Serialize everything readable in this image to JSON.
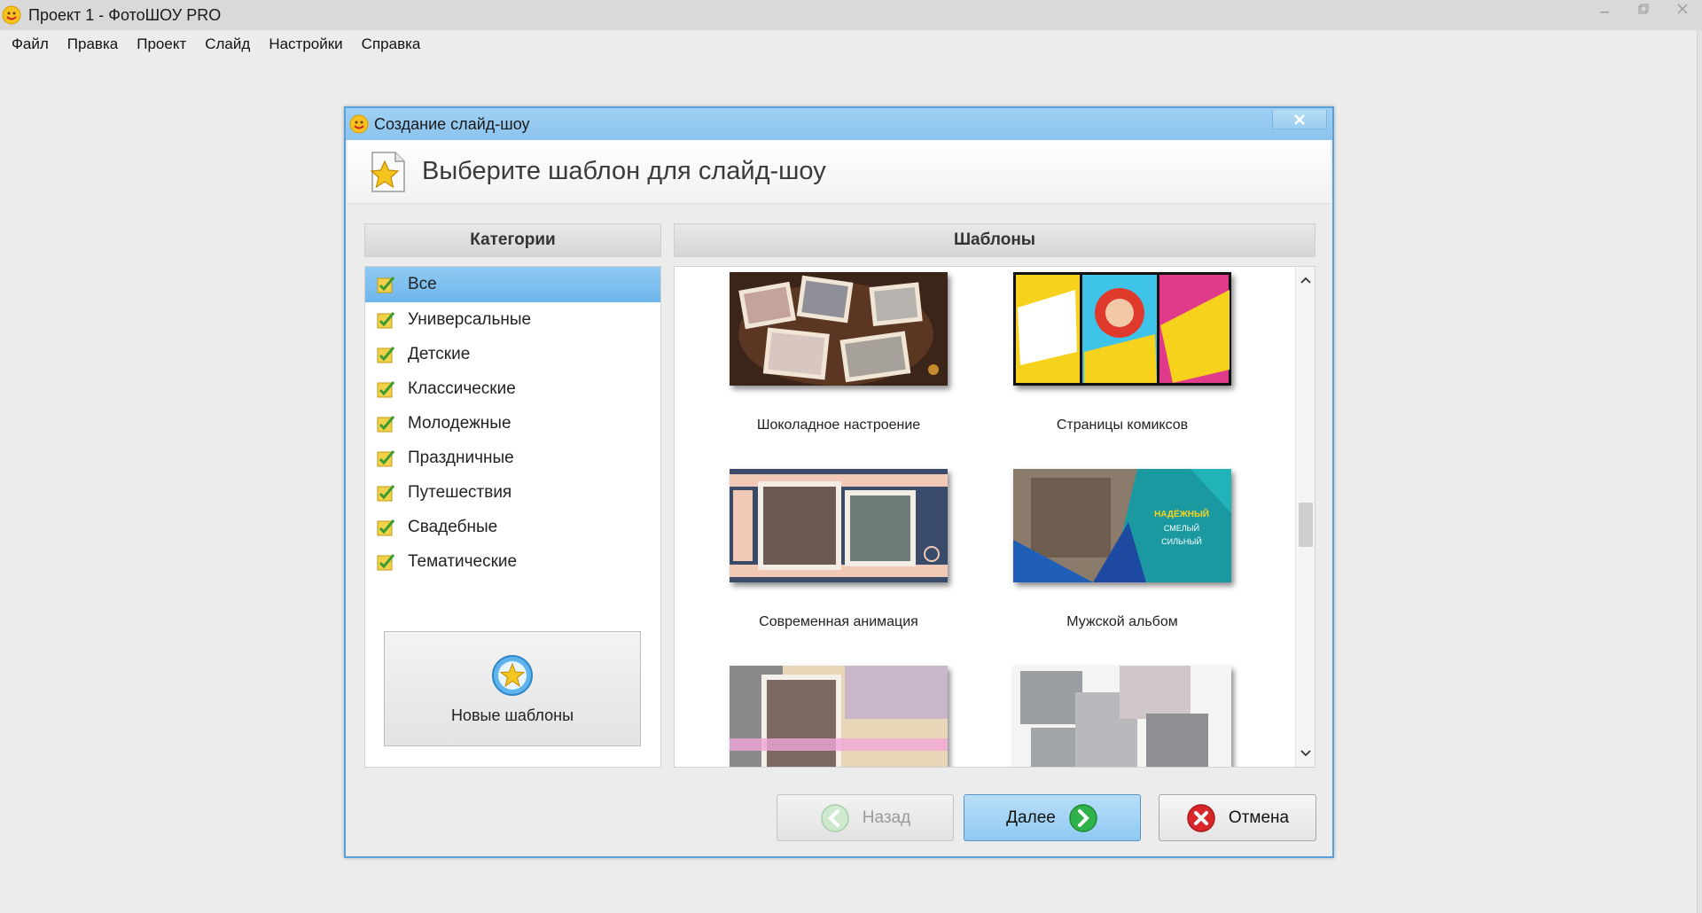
{
  "window": {
    "title": "Проект 1 - ФотоШОУ PRO",
    "controls": [
      "minimize-icon",
      "restore-icon",
      "close-icon"
    ]
  },
  "menu": [
    "Файл",
    "Правка",
    "Проект",
    "Слайд",
    "Настройки",
    "Справка"
  ],
  "dialog": {
    "title": "Создание слайд-шоу",
    "header": "Выберите шаблон для слайд-шоу",
    "categories_heading": "Категории",
    "templates_heading": "Шаблоны",
    "categories": [
      {
        "label": "Все",
        "selected": true
      },
      {
        "label": "Универсальные",
        "selected": false
      },
      {
        "label": "Детские",
        "selected": false
      },
      {
        "label": "Классические",
        "selected": false
      },
      {
        "label": "Молодежные",
        "selected": false
      },
      {
        "label": "Праздничные",
        "selected": false
      },
      {
        "label": "Путешествия",
        "selected": false
      },
      {
        "label": "Свадебные",
        "selected": false
      },
      {
        "label": "Тематические",
        "selected": false
      }
    ],
    "new_templates_label": "Новые шаблоны",
    "templates": [
      {
        "label": "Шоколадное настроение"
      },
      {
        "label": "Страницы комиксов"
      },
      {
        "label": "Современная анимация"
      },
      {
        "label": "Мужской альбом",
        "thumb_text": [
          "НАДЁЖНЫЙ",
          "СМЕЛЫЙ",
          "СИЛЬНЫЙ"
        ]
      },
      {
        "label": ""
      },
      {
        "label": ""
      }
    ],
    "buttons": {
      "back": "Назад",
      "next": "Далее",
      "cancel": "Отмена"
    }
  },
  "colors": {
    "accent_blue": "#8fcaf3",
    "dialog_border": "#5aa0d8",
    "next_icon": "#2fb24a",
    "cancel_icon": "#d9262b"
  }
}
